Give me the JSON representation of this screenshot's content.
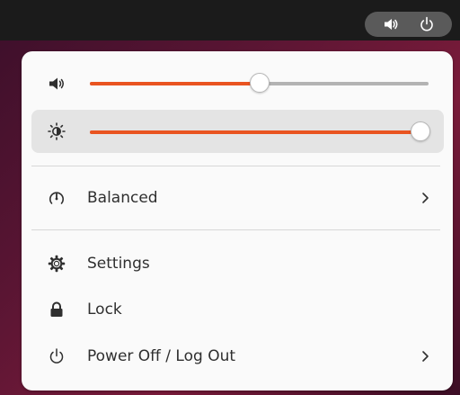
{
  "topbar": {
    "tray": {
      "volume_icon": "speaker-icon",
      "power_icon": "power-icon"
    }
  },
  "menu": {
    "volume": {
      "icon": "speaker-icon",
      "level": 0.5
    },
    "brightness": {
      "icon": "brightness-icon",
      "level": 1.0
    },
    "power_mode": {
      "label": "Balanced",
      "icon": "power-profile-icon"
    },
    "items": [
      {
        "label": "Settings",
        "icon": "gear-icon"
      },
      {
        "label": "Lock",
        "icon": "lock-icon"
      },
      {
        "label": "Power Off / Log Out",
        "icon": "power-icon"
      }
    ]
  },
  "colors": {
    "accent": "#e95420",
    "track": "#b3b3b3",
    "menu_bg": "#fafafa",
    "topbar_bg": "#1b1b1b"
  }
}
